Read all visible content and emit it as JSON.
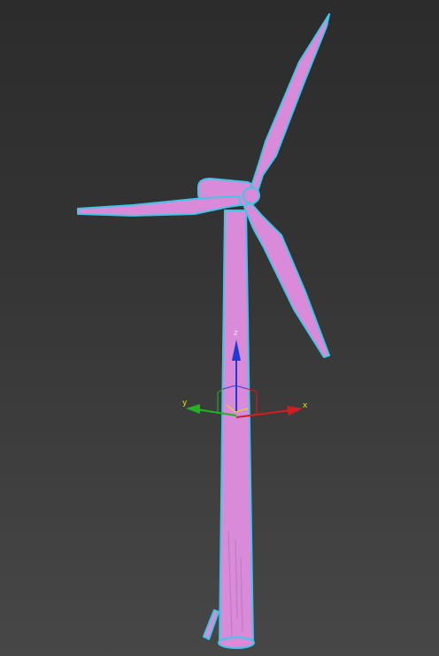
{
  "viewport": {
    "background_top": "#2c2c2c",
    "background_bottom": "#474747"
  },
  "model": {
    "fill_color": "#d98ad8",
    "selection_outline_color": "#3fc6e8",
    "shade_color": "#b56cb4"
  },
  "gizmo": {
    "x_label": "x",
    "y_label": "y",
    "z_label": "z",
    "x_color": "#d21e1e",
    "y_color": "#22b322",
    "z_color": "#1e3ad2",
    "x_label_color": "#e6e600",
    "y_label_color": "#e6e600",
    "z_label_color": "#e6e6e6"
  }
}
